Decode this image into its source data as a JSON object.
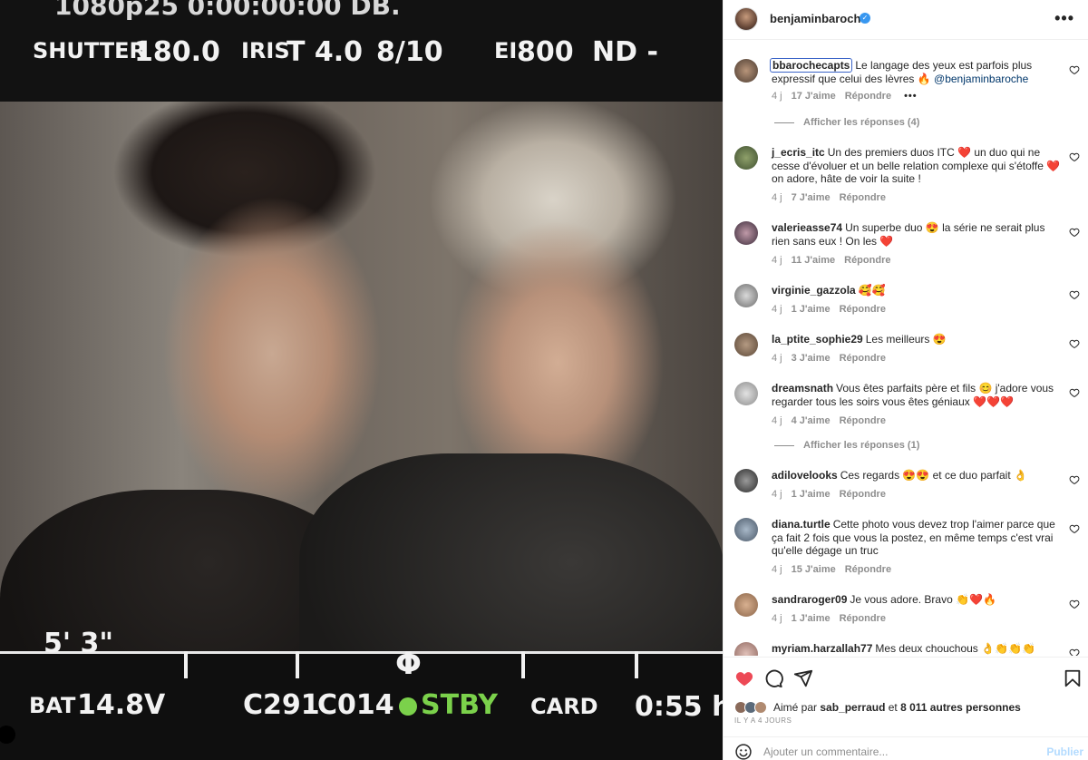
{
  "photo": {
    "hud": {
      "top_cut": "1080p25 0:00:00:00 DB.",
      "shutter_label": "SHUTTER",
      "shutter_value": "180.0",
      "iris_label": "IRIS",
      "iris_value": "T 4.0",
      "iris_fraction": "8/10",
      "ei_label": "EI",
      "ei_value": "800",
      "nd_label": "ND -",
      "focus": "5' 3\"",
      "bat_label": "BAT",
      "bat_value": "14.8V",
      "clip_c291": "C291",
      "clip_c014": "C014",
      "stby": "STBY",
      "card_label": "CARD",
      "card_time": "0:55 h"
    }
  },
  "post": {
    "username": "benjaminbaroche",
    "more_label": "•••"
  },
  "comments": [
    {
      "user": "bbarochecapts",
      "text": "Le langage des yeux est parfois plus expressif que celui des lèvres 🔥",
      "mention": "@benjaminbaroche",
      "time": "4 j",
      "likes": "17 J'aime",
      "reply": "Répondre",
      "more": "•••",
      "view_replies": "Afficher les réponses (4)"
    },
    {
      "user": "j_ecris_itc",
      "text": "Un des premiers duos ITC ❤️ un duo qui ne cesse d'évoluer et un belle relation complexe qui s'étoffe ❤️ on adore, hâte de voir la suite !",
      "time": "4 j",
      "likes": "7 J'aime",
      "reply": "Répondre"
    },
    {
      "user": "valerieasse74",
      "text": "Un superbe duo 😍 la série ne serait plus rien sans eux ! On les ❤️",
      "time": "4 j",
      "likes": "11 J'aime",
      "reply": "Répondre"
    },
    {
      "user": "virginie_gazzola",
      "text": "🥰🥰",
      "time": "4 j",
      "likes": "1 J'aime",
      "reply": "Répondre"
    },
    {
      "user": "la_ptite_sophie29",
      "text": "Les meilleurs 😍",
      "time": "4 j",
      "likes": "3 J'aime",
      "reply": "Répondre"
    },
    {
      "user": "dreamsnath",
      "text": "Vous êtes parfaits père et fils 😊 j'adore vous regarder tous les soirs vous êtes géniaux ❤️❤️❤️",
      "time": "4 j",
      "likes": "4 J'aime",
      "reply": "Répondre",
      "view_replies": "Afficher les réponses (1)"
    },
    {
      "user": "adilovelooks",
      "text": "Ces regards 😍😍 et ce duo parfait 👌",
      "time": "4 j",
      "likes": "1 J'aime",
      "reply": "Répondre"
    },
    {
      "user": "diana.turtle",
      "text": "Cette photo vous devez trop l'aimer parce que ça fait 2 fois que vous la postez, en même temps c'est vrai qu'elle dégage un truc",
      "time": "4 j",
      "likes": "15 J'aime",
      "reply": "Répondre"
    },
    {
      "user": "sandraroger09",
      "text": "Je vous adore. Bravo 👏❤️🔥",
      "time": "4 j",
      "likes": "1 J'aime",
      "reply": "Répondre"
    },
    {
      "user": "myriam.harzallah77",
      "text": "Mes deux chouchous 👌👏👏👏"
    }
  ],
  "actions": {
    "liked_by_prefix": "Aimé par",
    "liked_by_user": "sab_perraud",
    "liked_by_joiner": "et",
    "liked_by_others": "8 011 autres personnes",
    "time_ago": "IL Y A 4 JOURS",
    "comment_placeholder": "Ajouter un commentaire...",
    "publish_label": "Publier"
  },
  "colors": {
    "verified": "#3897f0",
    "like_red": "#ed4956",
    "stby_green": "#7bd14b",
    "link_blue": "#00376b"
  },
  "icons": [
    "verified-icon",
    "more-icon",
    "heart-icon",
    "comment-icon",
    "share-icon",
    "bookmark-icon",
    "emoji-icon"
  ]
}
